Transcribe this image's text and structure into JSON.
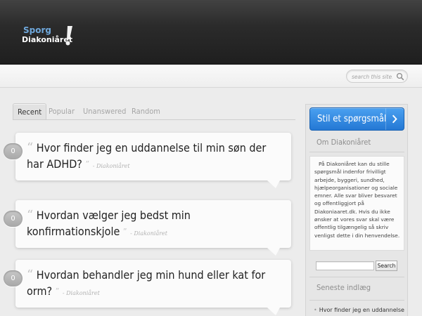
{
  "site": {
    "logo_line1": "Sporg",
    "logo_line2": "Diakoniåret",
    "logo_mark_icon": "exclamation-icon"
  },
  "search": {
    "placeholder": "search this site...",
    "icon": "search-icon"
  },
  "tabs": [
    {
      "label": "Recent",
      "active": true
    },
    {
      "label": "Popular",
      "active": false
    },
    {
      "label": "Unanswered",
      "active": false
    },
    {
      "label": "Random",
      "active": false
    }
  ],
  "questions": [
    {
      "answers": "0",
      "title": "Hvor finder jeg en uddannelse til min søn der har ADHD?",
      "author": "- Diakoniåret"
    },
    {
      "answers": "0",
      "title": "Hvordan vælger jeg bedst min konfirmationskjole",
      "author": "- Diakoniåret"
    },
    {
      "answers": "0",
      "title": "Hvordan behandler jeg min hund eller kat for orm?",
      "author": "- Diakoniåret"
    }
  ],
  "sidebar": {
    "ask_button": "Stil et spørgsmål",
    "about_heading": "Om Diakoniåret",
    "about_text": "På Diakoniåret kan du stille spørgsmål indenfor frivilligt arbejde, byggeri, sundhed, hjælpeorganisationer og sociale emner. Alle svar bliver besvaret og offentliggjort på Diakoniaaret.dk. Hvis du ikke ønsker at vores svar skal være offentlig tilgængelig så skriv venligst dette i din henvendelse.",
    "search_button": "Search",
    "recent_heading": "Seneste indlæg",
    "recent_items": [
      "Hvor finder jeg en uddannelse"
    ]
  },
  "colors": {
    "header_bg": "#2b2b2b",
    "accent_blue": "#2478d4",
    "logo_blue": "#6fa8dc"
  }
}
